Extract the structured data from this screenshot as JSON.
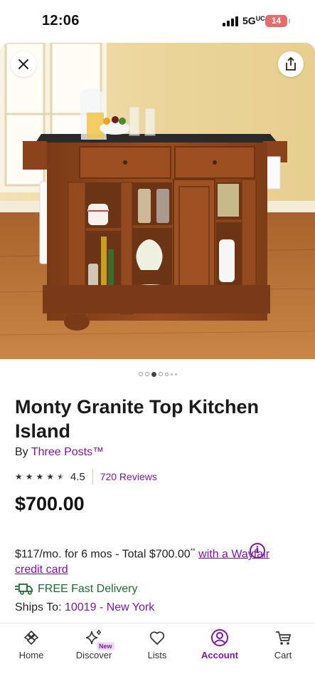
{
  "status_bar": {
    "time": "12:06",
    "network": "5G",
    "battery": "14"
  },
  "hero": {
    "image_description_icon": "kitchen-island-photo",
    "close_icon": "close-icon",
    "share_icon": "share-icon",
    "carousel_total": 7,
    "carousel_active": 3
  },
  "product": {
    "title": "Monty Granite Top Kitchen Island",
    "by_prefix": "By",
    "brand": "Three Posts™",
    "rating": "4.5",
    "rating_stars": 4.5,
    "reviews": "720 Reviews",
    "price": "$700.00"
  },
  "financing": {
    "text": "$117/mo. for 6 mos - Total $700.00",
    "superscript": "**",
    "link": "with a Wayfair credit card",
    "info_icon": "i"
  },
  "delivery": {
    "label": "FREE Fast Delivery",
    "ships_prefix": "Ships To:",
    "ships_location": "10019 - New York"
  },
  "tabs": [
    {
      "label": "Home",
      "icon": "home-icon"
    },
    {
      "label": "Discover",
      "icon": "sparkle-icon",
      "badge": "New"
    },
    {
      "label": "Lists",
      "icon": "heart-icon"
    },
    {
      "label": "Account",
      "icon": "account-icon",
      "active": true
    },
    {
      "label": "Cart",
      "icon": "cart-icon"
    }
  ],
  "colors": {
    "accent": "#7b189f",
    "delivery_green": "#1f6b35",
    "battery": "#e86b6b"
  }
}
